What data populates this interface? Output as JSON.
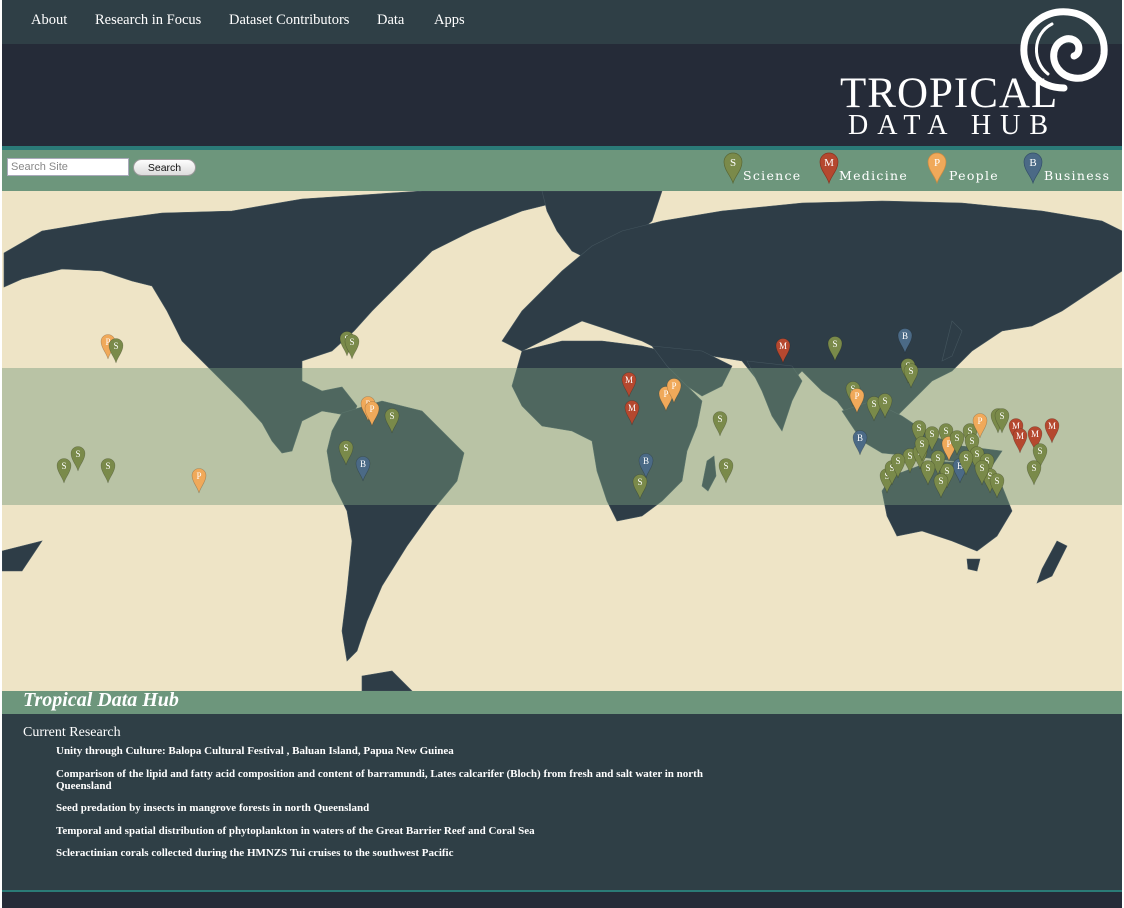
{
  "nav": {
    "items": [
      {
        "label": "About"
      },
      {
        "label": "Research in Focus"
      },
      {
        "label": "Dataset Contributors"
      },
      {
        "label": "Data"
      },
      {
        "label": "Apps"
      }
    ]
  },
  "logo": {
    "line1": "TROPICAL",
    "line2": "DATA HUB"
  },
  "search": {
    "placeholder": "Search Site",
    "button_label": "Search"
  },
  "legend": [
    {
      "key": "science",
      "letter": "S",
      "label": "Science",
      "color": "#7a8a4a"
    },
    {
      "key": "medicine",
      "letter": "M",
      "label": "Medicine",
      "color": "#b5482f"
    },
    {
      "key": "people",
      "letter": "P",
      "label": "People",
      "color": "#f0a95a"
    },
    {
      "key": "business",
      "letter": "B",
      "label": "Business",
      "color": "#4b6a86"
    }
  ],
  "colors": {
    "ocean": "#eee4c6",
    "land": "#2e3d47",
    "tropics_band": "rgba(120,155,125,0.45)",
    "header_green": "#6d967c",
    "teal": "#2b7a77"
  },
  "map": {
    "markers": [
      {
        "cat": "P"
      },
      {
        "cat": "S"
      },
      {
        "cat": "S"
      },
      {
        "cat": "S"
      },
      {
        "cat": "S"
      },
      {
        "cat": "S"
      },
      {
        "cat": "S"
      },
      {
        "cat": "P"
      },
      {
        "cat": "P"
      },
      {
        "cat": "P"
      },
      {
        "cat": "S"
      },
      {
        "cat": "S"
      },
      {
        "cat": "B"
      },
      {
        "cat": "M"
      },
      {
        "cat": "M"
      },
      {
        "cat": "P"
      },
      {
        "cat": "P"
      },
      {
        "cat": "S"
      },
      {
        "cat": "B"
      },
      {
        "cat": "S"
      },
      {
        "cat": "S"
      },
      {
        "cat": "M"
      },
      {
        "cat": "S"
      },
      {
        "cat": "B"
      },
      {
        "cat": "S"
      },
      {
        "cat": "S"
      },
      {
        "cat": "S"
      },
      {
        "cat": "P"
      },
      {
        "cat": "S"
      },
      {
        "cat": "S"
      },
      {
        "cat": "B"
      },
      {
        "cat": "S"
      },
      {
        "cat": "S"
      },
      {
        "cat": "S"
      },
      {
        "cat": "P"
      },
      {
        "cat": "S"
      },
      {
        "cat": "S"
      },
      {
        "cat": "P"
      },
      {
        "cat": "M"
      },
      {
        "cat": "S"
      },
      {
        "cat": "S"
      },
      {
        "cat": "S"
      },
      {
        "cat": "S"
      },
      {
        "cat": "M"
      },
      {
        "cat": "M"
      },
      {
        "cat": "M"
      },
      {
        "cat": "S"
      },
      {
        "cat": "S"
      },
      {
        "cat": "S"
      },
      {
        "cat": "S"
      },
      {
        "cat": "B"
      },
      {
        "cat": "S"
      },
      {
        "cat": "S"
      },
      {
        "cat": "S"
      },
      {
        "cat": "S"
      },
      {
        "cat": "S"
      },
      {
        "cat": "S"
      },
      {
        "cat": "S"
      },
      {
        "cat": "S"
      },
      {
        "cat": "S"
      },
      {
        "cat": "S"
      },
      {
        "cat": "S"
      },
      {
        "cat": "S"
      },
      {
        "cat": "S"
      }
    ]
  },
  "section": {
    "title": "Tropical Data Hub"
  },
  "research": {
    "title": "Current Research",
    "items": [
      {
        "label": "Unity through Culture: Balopa Cultural Festival , Baluan Island, Papua New Guinea"
      },
      {
        "label": "Comparison of the lipid and fatty acid composition and content of barramundi, Lates calcarifer (Bloch) from fresh and salt water in north Queensland"
      },
      {
        "label": "Seed predation by insects in mangrove forests in north Queensland"
      },
      {
        "label": "Temporal and spatial distribution of phytoplankton in waters of the Great Barrier Reef and Coral Sea"
      },
      {
        "label": "Scleractinian corals collected during the HMNZS Tui cruises to the southwest Pacific"
      }
    ]
  }
}
